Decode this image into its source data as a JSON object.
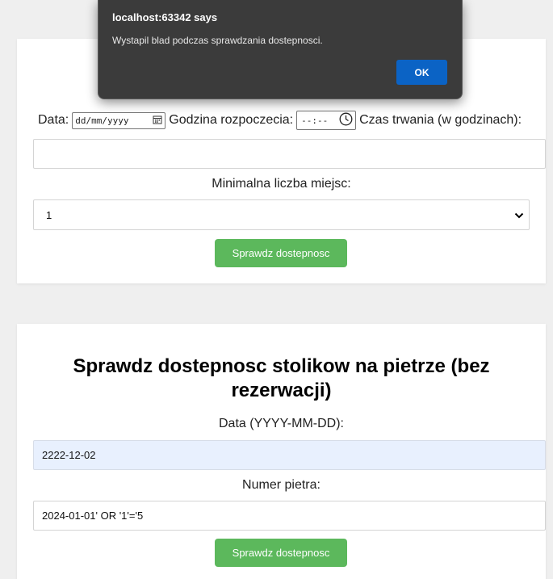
{
  "form1": {
    "date_label": "Data:",
    "date_placeholder": "dd/mm/yyyy",
    "start_label": "Godzina rozpoczecia:",
    "time_placeholder": "--:--",
    "duration_label": "Czas trwania (w godzinach):",
    "duration_value": "",
    "min_seats_label": "Minimalna liczba miejsc:",
    "min_seats_value": "1",
    "check_button": "Sprawdz dostepnosc"
  },
  "form2": {
    "title": "Sprawdz dostepnosc stolikow na pietrze (bez rezerwacji)",
    "date_label": "Data (YYYY-MM-DD):",
    "date_value": "2222-12-02",
    "floor_label": "Numer pietra:",
    "floor_value": "2024-01-01' OR '1'='5",
    "check_button": "Sprawdz dostepnosc"
  },
  "dialog": {
    "title": "localhost:63342 says",
    "message": "Wystapil blad podczas sprawdzania dostepnosci.",
    "ok_label": "OK"
  },
  "icons": {
    "calendar": "calendar-icon",
    "clock": "clock-icon",
    "dropdown": "chevron-down-icon"
  }
}
